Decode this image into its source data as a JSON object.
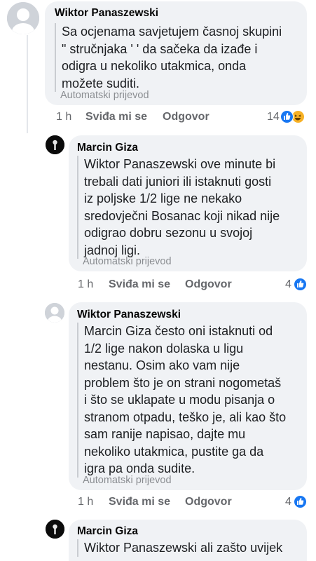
{
  "comments": [
    {
      "author": "Wiktor Panaszewski",
      "text": "Sa ocjenama savjetujem časnoj skupini\n\" stručnjaka ' ' da sačeka da izađe i\nodigra u nekoliko utakmica, onda\nmožete suditi.",
      "translated": "Automatski prijevod",
      "time": "1 h",
      "like": "Sviđa mi se",
      "reply": "Odgovor",
      "reactions": "14",
      "reaction_icons": [
        "like-icon",
        "haha-icon"
      ],
      "avatar": "default-avatar-icon"
    },
    {
      "author": "Marcin Giza",
      "text": "Wiktor Panaszewski ove minute bi\ntrebali dati juniori ili istaknuti gosti\niz poljske 1/2 lige ne nekako\nsredovječni Bosanac koji nikad nije\nodigrao dobru sezonu u svojoj\njadnoj ligi.",
      "translated": "Automatski prijevod",
      "time": "1 h",
      "like": "Sviđa mi se",
      "reply": "Odgovor",
      "reactions": "4",
      "reaction_icons": [
        "like-icon"
      ],
      "avatar": "dark-avatar-icon"
    },
    {
      "author": "Wiktor Panaszewski",
      "text": "Marcin Giza često oni istaknuti od\n1/2 lige nakon dolaska u ligu\nnestanu. Osim ako vam nije\nproblem što je on strani nogometaš\ni što se uklapate u modu pisanja o\nstranom otpadu, teško je, ali kao što\nsam ranije napisao, dajte mu\nnekoliko utakmica, pustite ga da\nigra pa onda sudite.",
      "translated": "Automatski prijevod",
      "time": "1 h",
      "like": "Sviđa mi se",
      "reply": "Odgovor",
      "reactions": "4",
      "reaction_icons": [
        "like-icon"
      ],
      "avatar": "default-avatar-icon"
    },
    {
      "author": "Marcin Giza",
      "text": "Wiktor Panaszewski ali zašto uvijek",
      "avatar": "dark-avatar-icon"
    }
  ],
  "colors": {
    "bubble": "#f0f2f5",
    "like": "#1877f2",
    "haha": "#f7b125",
    "meta": "#65676b"
  }
}
